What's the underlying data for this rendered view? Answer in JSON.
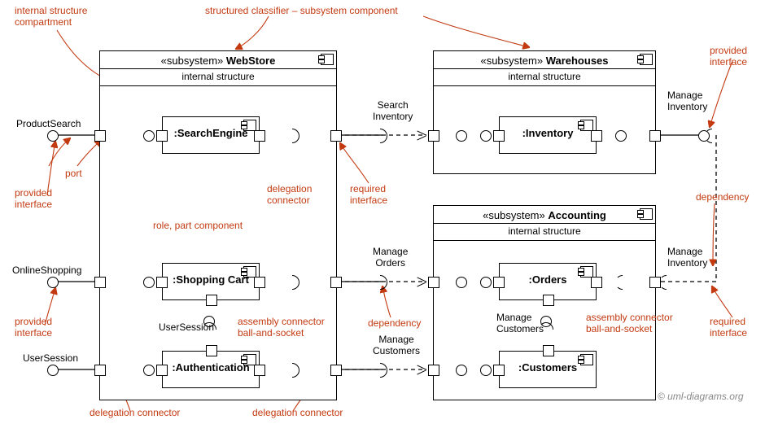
{
  "subsystems": {
    "webstore": {
      "stereotype": "«subsystem»",
      "name": "WebStore",
      "subtitle": "internal structure"
    },
    "warehouses": {
      "stereotype": "«subsystem»",
      "name": "Warehouses",
      "subtitle": "internal structure"
    },
    "accounting": {
      "stereotype": "«subsystem»",
      "name": "Accounting",
      "subtitle": "internal structure"
    }
  },
  "components": {
    "searchEngine": ":SearchEngine",
    "shoppingCart": ":Shopping Cart",
    "authentication": ":Authentication",
    "inventory": ":Inventory",
    "orders": ":Orders",
    "customers": ":Customers"
  },
  "interfaces": {
    "productSearch": "ProductSearch",
    "onlineShopping": "OnlineShopping",
    "userSession": "UserSession",
    "userSessionInner": "UserSession",
    "searchInventory": "Search\nInventory",
    "manageInventory1": "Manage\nInventory",
    "manageInventory2": "Manage\nInventory",
    "manageOrders": "Manage\nOrders",
    "manageCustomers1": "Manage\nCustomers",
    "manageCustomers2": "Manage\nCustomers"
  },
  "annotations": {
    "internalStructureCompartment": "internal structure\ncompartment",
    "structuredClassifier": "structured classifier – subsystem component",
    "providedInterface1": "provided\ninterface",
    "providedInterface2": "provided\ninterface",
    "providedInterface3": "provided\ninterface",
    "port": "port",
    "rolePartComponent": "role, part component",
    "delegationConnector1": "delegation\nconnector",
    "delegationConnector2": "delegation connector",
    "delegationConnector3": "delegation connector",
    "requiredInterface1": "required\ninterface",
    "requiredInterface2": "required\ninterface",
    "dependency1": "dependency",
    "dependency2": "dependency",
    "assemblyConnector1": "assembly connector\nball-and-socket",
    "assemblyConnector2": "assembly connector\nball-and-socket"
  },
  "credit": "© uml-diagrams.org"
}
